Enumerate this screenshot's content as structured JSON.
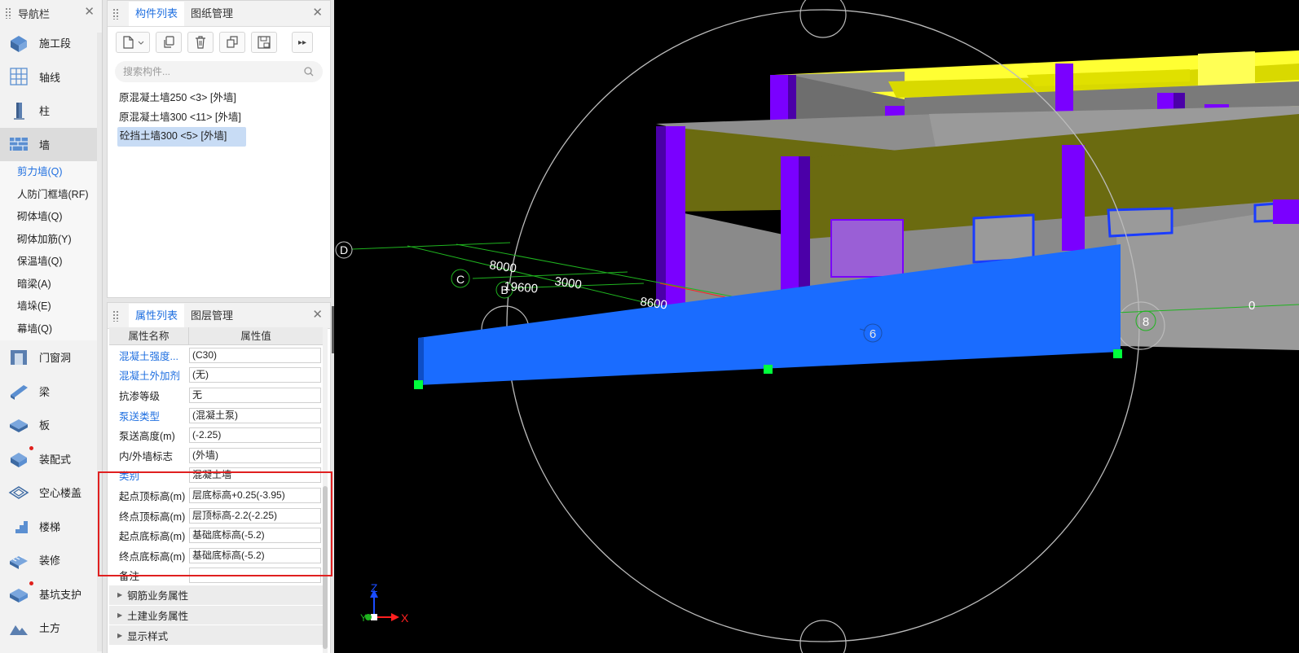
{
  "nav": {
    "title": "导航栏",
    "items_top": [
      {
        "label": "施工段",
        "icon": "construction-stage-icon"
      },
      {
        "label": "轴线",
        "icon": "grid-axis-icon"
      },
      {
        "label": "柱",
        "icon": "column-icon"
      },
      {
        "label": "墙",
        "icon": "wall-icon",
        "active": true
      }
    ],
    "sub_items": [
      {
        "label": "剪力墙(Q)",
        "active": true
      },
      {
        "label": "人防门框墙(RF)"
      },
      {
        "label": "砌体墙(Q)"
      },
      {
        "label": "砌体加筋(Y)"
      },
      {
        "label": "保温墙(Q)"
      },
      {
        "label": "暗梁(A)"
      },
      {
        "label": "墙垛(E)"
      },
      {
        "label": "幕墙(Q)"
      }
    ],
    "items_bottom": [
      {
        "label": "门窗洞",
        "icon": "door-window-icon"
      },
      {
        "label": "梁",
        "icon": "beam-icon"
      },
      {
        "label": "板",
        "icon": "slab-icon"
      },
      {
        "label": "装配式",
        "icon": "prefab-icon",
        "dot": true
      },
      {
        "label": "空心楼盖",
        "icon": "hollow-floor-icon"
      },
      {
        "label": "楼梯",
        "icon": "stairs-icon"
      },
      {
        "label": "装修",
        "icon": "decoration-icon"
      },
      {
        "label": "基坑支护",
        "icon": "foundation-pit-icon",
        "dot": true
      },
      {
        "label": "土方",
        "icon": "earthwork-icon"
      }
    ]
  },
  "components": {
    "tabs": [
      "构件列表",
      "图纸管理"
    ],
    "search_placeholder": "搜索构件...",
    "items": [
      "原混凝土墙250 <3> [外墙]",
      "原混凝土墙300 <11> [外墙]",
      "砼挡土墙300 <5> [外墙]"
    ],
    "selected_index": 2
  },
  "properties": {
    "tabs": [
      "属性列表",
      "图层管理"
    ],
    "col_name": "属性名称",
    "col_value": "属性值",
    "rows": [
      {
        "name": "混凝土强度...",
        "value": "(C30)",
        "link": true
      },
      {
        "name": "混凝土外加剂",
        "value": "(无)",
        "link": true
      },
      {
        "name": "抗渗等级",
        "value": "无"
      },
      {
        "name": "泵送类型",
        "value": "(混凝土泵)",
        "link": true
      },
      {
        "name": "泵送高度(m)",
        "value": "(-2.25)"
      },
      {
        "name": "内/外墙标志",
        "value": "(外墙)"
      },
      {
        "name": "类别",
        "value": "混凝土墙",
        "link": true
      },
      {
        "name": "起点顶标高(m)",
        "value": "层底标高+0.25(-3.95)"
      },
      {
        "name": "终点顶标高(m)",
        "value": "层顶标高-2.2(-2.25)"
      },
      {
        "name": "起点底标高(m)",
        "value": "基础底标高(-5.2)"
      },
      {
        "name": "终点底标高(m)",
        "value": "基础底标高(-5.2)"
      },
      {
        "name": "备注",
        "value": ""
      }
    ],
    "groups": [
      "钢筋业务属性",
      "土建业务属性",
      "显示样式"
    ]
  },
  "viewport": {
    "grid_labels": [
      "D",
      "C",
      "B",
      "6",
      "8"
    ],
    "dimensions": [
      "8000",
      "19600",
      "3000",
      "8600",
      "0"
    ],
    "axis": {
      "x": "X",
      "y": "Y",
      "z": "Z"
    },
    "colors": {
      "background": "#000000",
      "selected_wall": "#1a6cff",
      "column": "#7a00ff",
      "wall_top": "#ffff33",
      "wall_face": "#6b6b10",
      "grip": "#00ff3c"
    }
  }
}
